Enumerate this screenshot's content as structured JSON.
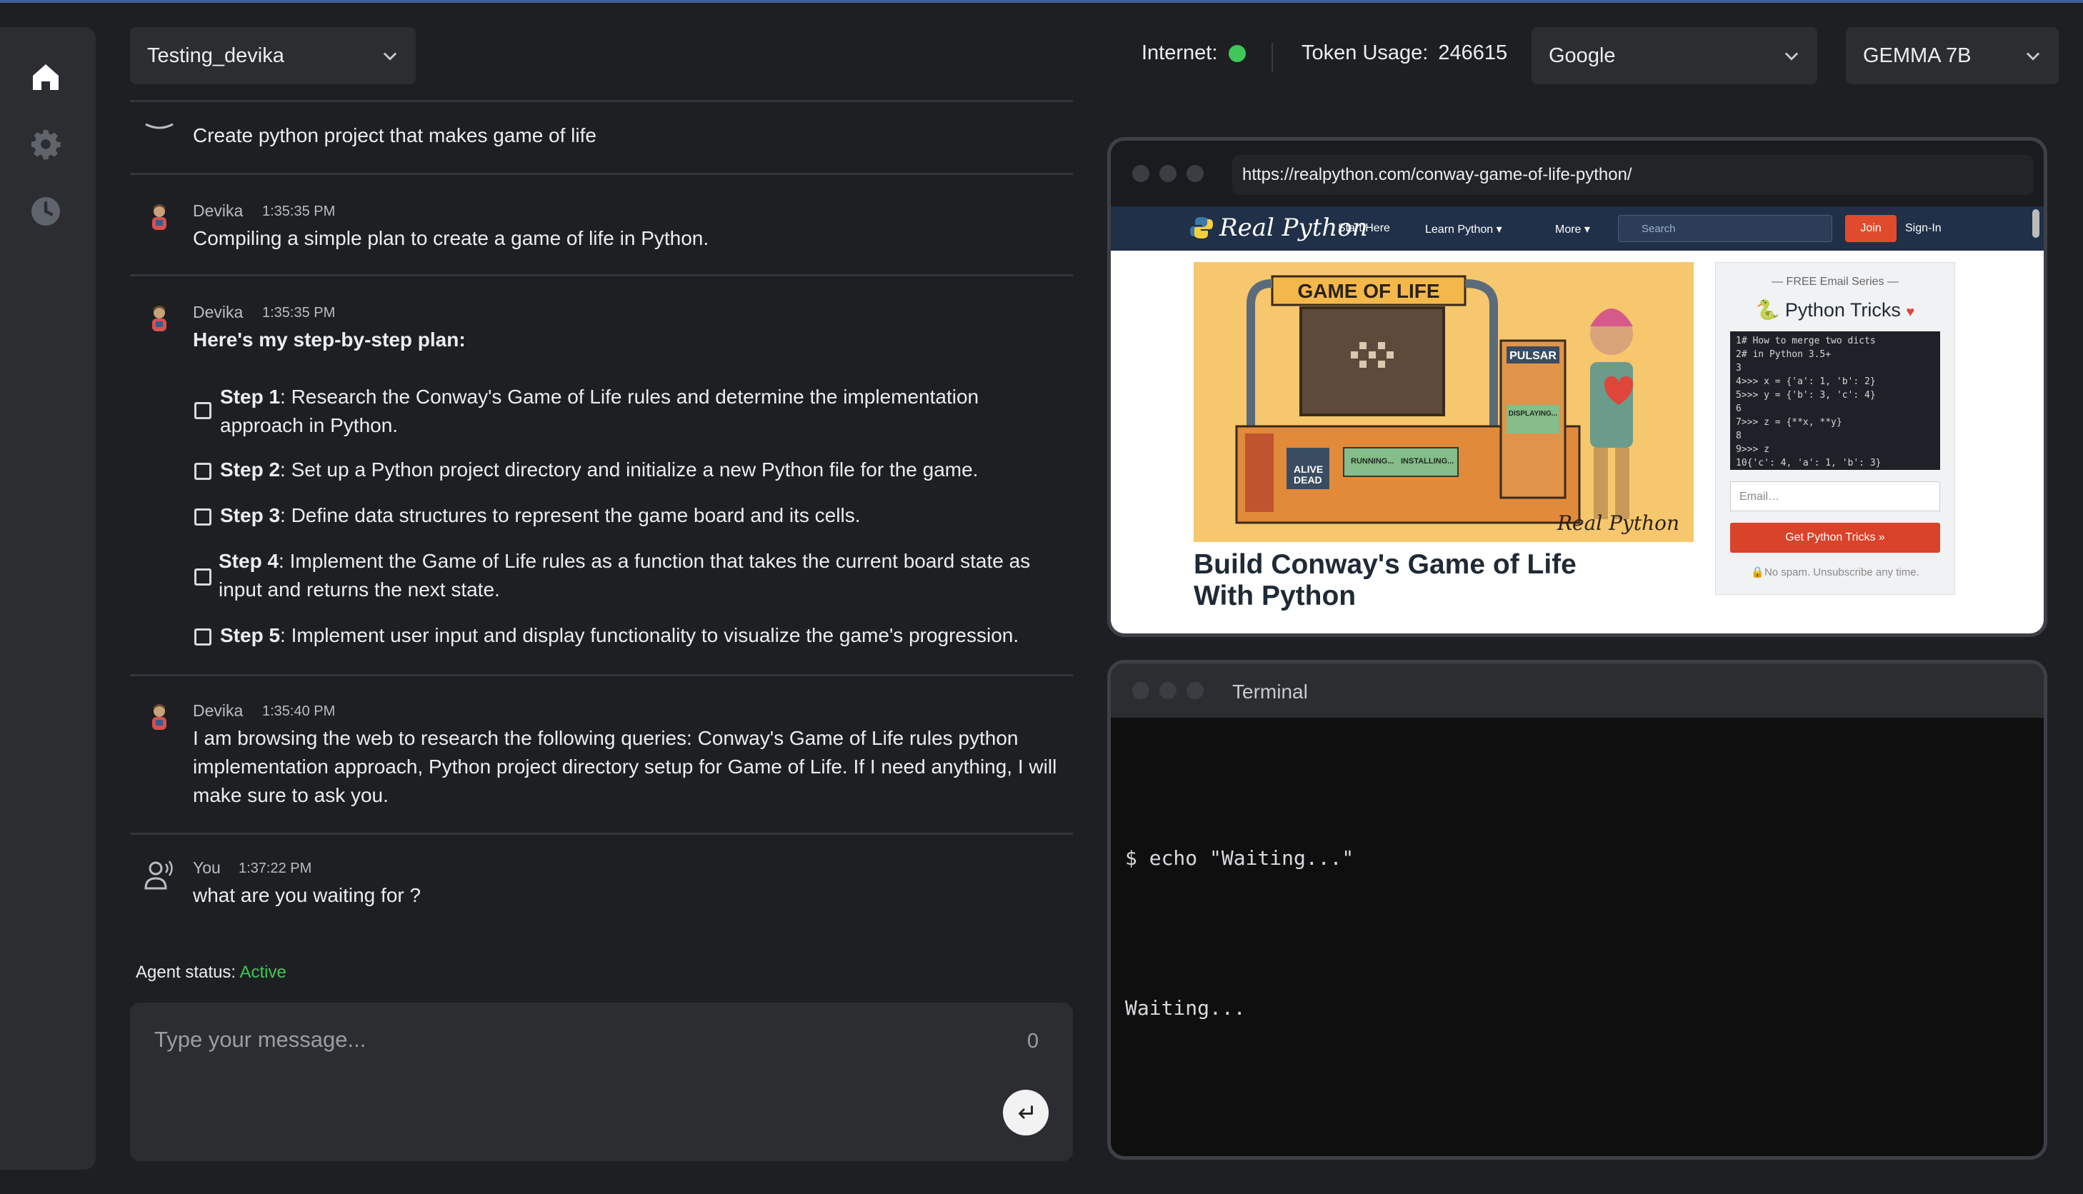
{
  "header": {
    "project": "Testing_devika",
    "internet_label": "Internet:",
    "token_label": "Token Usage:",
    "token_value": "246615",
    "search_engine": "Google",
    "model": "GEMMA 7B",
    "internet_status_color": "#3fc75a"
  },
  "sidebar": {
    "items": [
      {
        "icon": "home-icon"
      },
      {
        "icon": "gear-icon"
      },
      {
        "icon": "clock-icon"
      }
    ]
  },
  "chat": {
    "messages": [
      {
        "author": "",
        "time": "",
        "text": "Create python project that makes game of life"
      },
      {
        "author": "Devika",
        "time": "1:35:35 PM",
        "text": "Compiling a simple plan to create a game of life in Python."
      },
      {
        "author": "Devika",
        "time": "1:35:35 PM",
        "heading": "Here's my step-by-step plan:",
        "steps": [
          {
            "label": "Step 1",
            "text": ": Research the Conway's Game of Life rules and determine the implementation",
            "text2": "approach in Python."
          },
          {
            "label": "Step 2",
            "text": ": Set up a Python project directory and initialize a new Python file for the game."
          },
          {
            "label": "Step 3",
            "text": ": Define data structures to represent the game board and its cells."
          },
          {
            "label": "Step 4",
            "text": ": Implement the Game of Life rules as a function that takes the current board state as",
            "text2": "input and returns the next state."
          },
          {
            "label": "Step 5",
            "text": ": Implement user input and display functionality to visualize the game's progression."
          }
        ]
      },
      {
        "author": "Devika",
        "time": "1:35:40 PM",
        "line1": "I am browsing the web to research the following queries: Conway's Game of Life rules python",
        "line2": "implementation approach, Python project directory setup for Game of Life. If I need anything, I will",
        "line3": "make sure to ask you."
      },
      {
        "author": "You",
        "time": "1:37:22 PM",
        "text": "what are you waiting for ?"
      }
    ],
    "agent_status_label": "Agent status:",
    "agent_status_value": "Active",
    "input_placeholder": "Type your message...",
    "char_count": "0"
  },
  "browser": {
    "url": "https://realpython.com/conway-game-of-life-python/",
    "site": {
      "logo": "Real Python",
      "nav": [
        "Start Here",
        "Learn Python ▾",
        "More ▾"
      ],
      "search_placeholder": "Search",
      "join": "Join",
      "signin": "Sign-In",
      "banner_title": "GAME OF LIFE",
      "banner_labels": [
        "PULSAR",
        "ALIVE",
        "DEAD",
        "RUNNING...",
        "INSTALLING...",
        "DISPLAYING..."
      ],
      "banner_brand": "Real Python",
      "article_title_1": "Build Conway's Game of Life",
      "article_title_2": "With Python",
      "email_series": "— FREE Email Series —",
      "email_title": "Python Tricks",
      "code": "1# How to merge two dicts\n2# in Python 3.5+\n3\n4>>> x = {'a': 1, 'b': 2}\n5>>> y = {'b': 3, 'c': 4}\n6\n7>>> z = {**x, **y}\n8\n9>>> z\n10{'c': 4, 'a': 1, 'b': 3}",
      "email_placeholder": "Email…",
      "cta": "Get Python Tricks »",
      "spam": "No spam. Unsubscribe any time."
    }
  },
  "terminal": {
    "title": "Terminal",
    "line1": "$ echo \"Waiting...\"",
    "line2": "Waiting..."
  }
}
